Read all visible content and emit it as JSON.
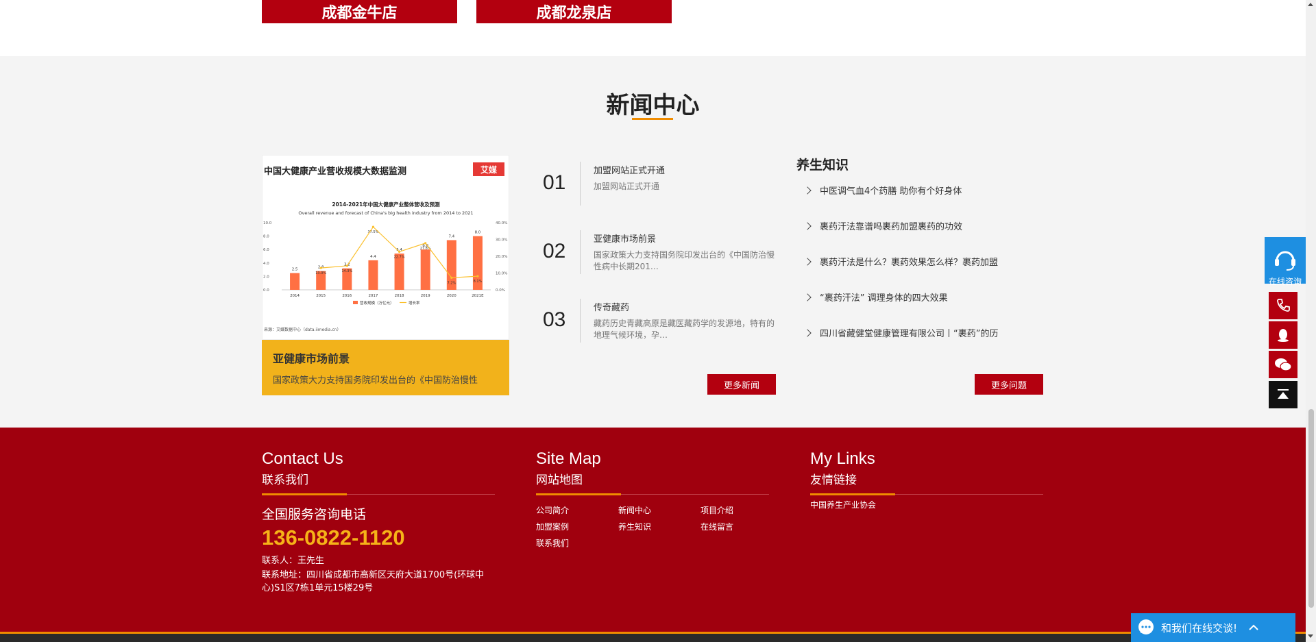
{
  "stores": [
    {
      "label": "成都金牛店"
    },
    {
      "label": "成都龙泉店"
    }
  ],
  "news_center": {
    "title": "新闻中心",
    "feature": {
      "image_title": "中国大健康产业营收规模大数据监测",
      "image_logo": "艾媒",
      "caption_title": "亚健康市场前景",
      "caption_desc": "国家政策大力支持国务院印发出台的《中国防治慢性"
    },
    "items": [
      {
        "num": "01",
        "title": "加盟网站正式开通",
        "desc": "加盟网站正式开通"
      },
      {
        "num": "02",
        "title": "亚健康市场前景",
        "desc": "国家政策大力支持国务院印发出台的《中国防治慢性病中长期201…"
      },
      {
        "num": "03",
        "title": "传奇藏药",
        "desc": "藏药历史青藏高原是藏医藏药学的发源地，特有的地理气候环境，孕…"
      }
    ],
    "more_news": "更多新闻",
    "knowledge": {
      "title": "养生知识",
      "items": [
        "中医调气血4个药膳 助你有个好身体",
        "裹药汗法靠谱吗裹药加盟裹药的功效",
        "裹药汗法是什么？裹药效果怎么样？裹药加盟",
        "“裹药汗法” 调理身体的四大效果",
        "四川省藏健堂健康管理有限公司丨“裹药”的历"
      ],
      "more": "更多问题"
    }
  },
  "chart_data": {
    "type": "bar",
    "title": "2014-2021年中国大健康产业整体营收及预测",
    "subtitle": "Overall revenue and forecast of China's big health industry from 2014 to 2021",
    "categories": [
      "2014",
      "2015",
      "2016",
      "2017",
      "2018",
      "2019",
      "2020",
      "2021E"
    ],
    "series": [
      {
        "name": "营收规模（万亿元）",
        "type": "bar",
        "values": [
          2.5,
          2.8,
          3.2,
          4.4,
          5.4,
          6.0,
          7.4,
          8.0
        ]
      },
      {
        "name": "增长率",
        "type": "line",
        "values": [
          null,
          13.0,
          14.3,
          37.5,
          22.7,
          27.8,
          7.2,
          8.1
        ]
      }
    ],
    "data_labels_bar": [
      "2.5",
      "2.8",
      "3.2",
      "4.4",
      "5.4",
      "6.0",
      "7.4",
      "8.0"
    ],
    "data_labels_line": [
      "",
      "13.0%",
      "14.3%",
      "37.5%",
      "22.7%",
      "27.8%",
      "7.2%",
      "8.1%"
    ],
    "y_ticks_left": [
      "10.0",
      "8.0",
      "6.0",
      "4.0",
      "2.0",
      "0.0"
    ],
    "y_ticks_right": [
      "40.0%",
      "30.0%",
      "20.0%",
      "10.0%",
      "0.0%"
    ],
    "ylim": [
      0,
      10
    ],
    "ylim_right": [
      0,
      40
    ],
    "source": "来源：艾媒数据中心（data.iimedia.cn）",
    "colors": {
      "bar": "#ff7043",
      "line": "#fbc02d"
    }
  },
  "footer": {
    "contact": {
      "title_en": "Contact Us",
      "title_cn": "联系我们",
      "hotline_label": "全国服务咨询电话",
      "hotline": "136-0822-1120",
      "person": "联系人：王先生",
      "address": "联系地址：四川省成都市高新区天府大道1700号(环球中心)S1区7栋1单元15楼29号"
    },
    "sitemap": {
      "title_en": "Site Map",
      "title_cn": "网站地图",
      "links": [
        "公司简介",
        "新闻中心",
        "项目介绍",
        "加盟案例",
        "养生知识",
        "在线留言",
        "联系我们"
      ]
    },
    "links": {
      "title_en": "My Links",
      "title_cn": "友情链接",
      "items": [
        "中国养生产业协会"
      ]
    }
  },
  "side": {
    "consult_label": "在线咨询"
  },
  "chat_bar": {
    "label": "和我们在线交谈!"
  },
  "colors": {
    "brand_red": "#b3000f",
    "footer_red": "#a0000e",
    "accent_orange": "#f08c00",
    "caption_yellow": "#f2b21b",
    "chat_blue": "#1e8fe1"
  }
}
